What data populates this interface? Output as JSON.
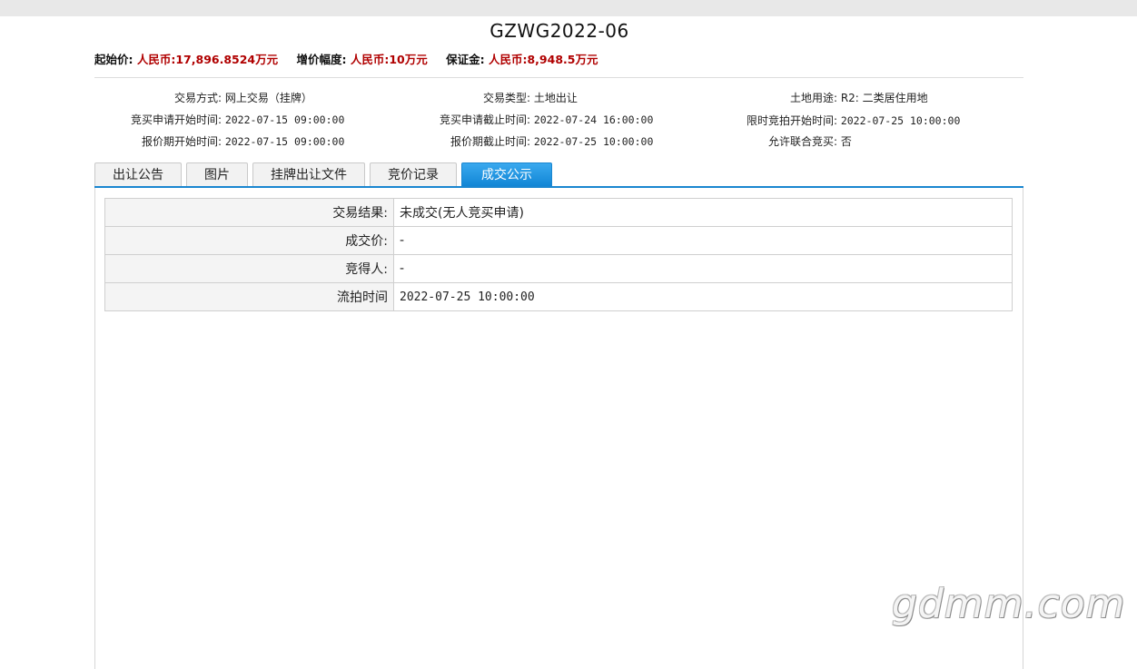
{
  "page_title": "GZWG2022-06",
  "price": {
    "start_label": "起始价:",
    "start_value": "人民币:17,896.8524万元",
    "increment_label": "增价幅度:",
    "increment_value": "人民币:10万元",
    "deposit_label": "保证金:",
    "deposit_value": "人民币:8,948.5万元"
  },
  "info": {
    "trade_mode_label": "交易方式:",
    "trade_mode_value": "网上交易（挂牌）",
    "trade_type_label": "交易类型:",
    "trade_type_value": "土地出让",
    "land_use_label": "土地用途:",
    "land_use_value": "R2: 二类居住用地",
    "apply_start_label": "竞买申请开始时间:",
    "apply_start_value": "2022-07-15 09:00:00",
    "apply_end_label": "竞买申请截止时间:",
    "apply_end_value": "2022-07-24 16:00:00",
    "auction_start_label": "限时竞拍开始时间:",
    "auction_start_value": "2022-07-25 10:00:00",
    "quote_start_label": "报价期开始时间:",
    "quote_start_value": "2022-07-15 09:00:00",
    "quote_end_label": "报价期截止时间:",
    "quote_end_value": "2022-07-25 10:00:00",
    "joint_label": "允许联合竞买:",
    "joint_value": "否"
  },
  "tabs": [
    "出让公告",
    "图片",
    "挂牌出让文件",
    "竞价记录",
    "成交公示"
  ],
  "active_tab": "成交公示",
  "result": {
    "rows": [
      {
        "label": "交易结果:",
        "value": "未成交(无人竞买申请)"
      },
      {
        "label": "成交价:",
        "value": "-"
      },
      {
        "label": "竞得人:",
        "value": "-"
      },
      {
        "label": "流拍时间",
        "value": "2022-07-25 10:00:00"
      }
    ]
  },
  "watermark": "gdmm.com",
  "colors": {
    "accent": "#1a86d0",
    "price_red": "#b00000"
  }
}
